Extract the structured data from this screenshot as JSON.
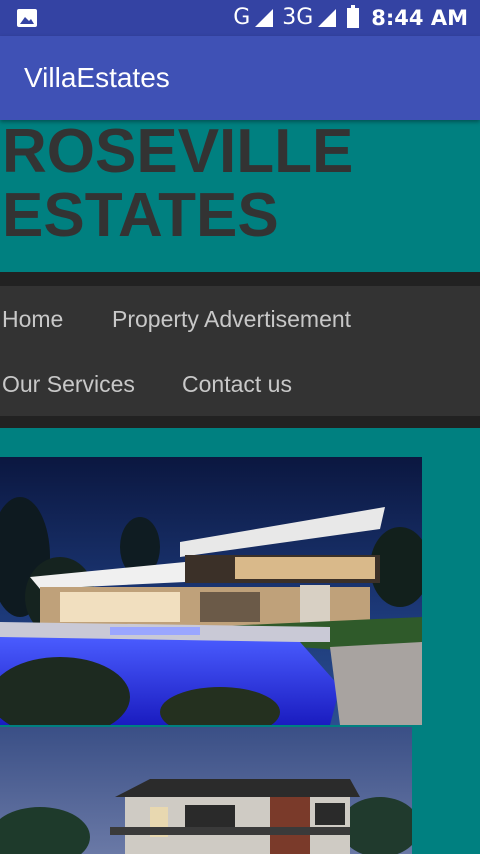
{
  "status_bar": {
    "network_g": "G",
    "network_3g": "3G",
    "time": "8:44 AM"
  },
  "app_bar": {
    "title": "VillaEstates"
  },
  "site": {
    "title_line1": "ROSEVILLE",
    "title_line2": "ESTATES"
  },
  "nav": {
    "items": [
      "Home",
      "Property Advertisement",
      "Our Services",
      "Contact us"
    ]
  },
  "gallery": {
    "images": [
      "modern-villa-pool-photo",
      "two-storey-house-dusk-photo"
    ]
  },
  "colors": {
    "status_bar": "#3443a3",
    "app_bar": "#3f51b5",
    "page_background": "#008080",
    "title_text": "#333333",
    "nav_background": "#333333",
    "nav_text": "#c8c8c8"
  }
}
